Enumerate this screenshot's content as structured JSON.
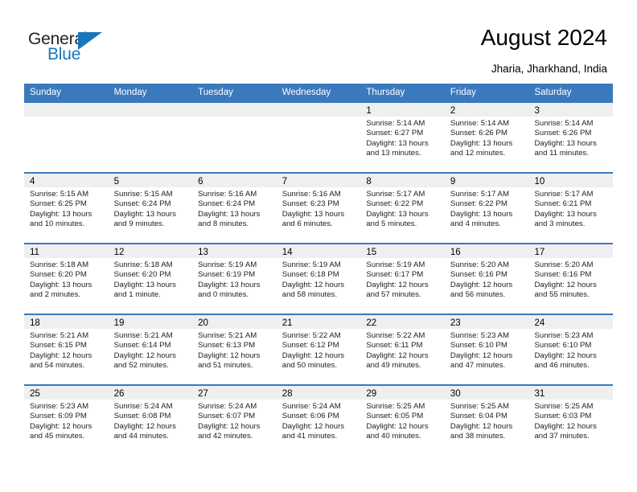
{
  "brand": {
    "name_part1": "General",
    "name_part2": "Blue",
    "triangle_color": "#1b75bb",
    "text_color": "#231f20"
  },
  "header": {
    "title": "August 2024",
    "subtitle": "Jharia, Jharkhand, India"
  },
  "theme": {
    "header_blue": "#3a79bd",
    "row_divider_blue": "#3a79bd",
    "day_band_gray": "#efefef",
    "background": "#ffffff"
  },
  "weekdays": [
    "Sunday",
    "Monday",
    "Tuesday",
    "Wednesday",
    "Thursday",
    "Friday",
    "Saturday"
  ],
  "weeks": [
    [
      {
        "day": "",
        "sunrise": "",
        "sunset": "",
        "daylight_line1": "",
        "daylight_line2": ""
      },
      {
        "day": "",
        "sunrise": "",
        "sunset": "",
        "daylight_line1": "",
        "daylight_line2": ""
      },
      {
        "day": "",
        "sunrise": "",
        "sunset": "",
        "daylight_line1": "",
        "daylight_line2": ""
      },
      {
        "day": "",
        "sunrise": "",
        "sunset": "",
        "daylight_line1": "",
        "daylight_line2": ""
      },
      {
        "day": "1",
        "sunrise": "Sunrise: 5:14 AM",
        "sunset": "Sunset: 6:27 PM",
        "daylight_line1": "Daylight: 13 hours",
        "daylight_line2": "and 13 minutes."
      },
      {
        "day": "2",
        "sunrise": "Sunrise: 5:14 AM",
        "sunset": "Sunset: 6:26 PM",
        "daylight_line1": "Daylight: 13 hours",
        "daylight_line2": "and 12 minutes."
      },
      {
        "day": "3",
        "sunrise": "Sunrise: 5:14 AM",
        "sunset": "Sunset: 6:26 PM",
        "daylight_line1": "Daylight: 13 hours",
        "daylight_line2": "and 11 minutes."
      }
    ],
    [
      {
        "day": "4",
        "sunrise": "Sunrise: 5:15 AM",
        "sunset": "Sunset: 6:25 PM",
        "daylight_line1": "Daylight: 13 hours",
        "daylight_line2": "and 10 minutes."
      },
      {
        "day": "5",
        "sunrise": "Sunrise: 5:15 AM",
        "sunset": "Sunset: 6:24 PM",
        "daylight_line1": "Daylight: 13 hours",
        "daylight_line2": "and 9 minutes."
      },
      {
        "day": "6",
        "sunrise": "Sunrise: 5:16 AM",
        "sunset": "Sunset: 6:24 PM",
        "daylight_line1": "Daylight: 13 hours",
        "daylight_line2": "and 8 minutes."
      },
      {
        "day": "7",
        "sunrise": "Sunrise: 5:16 AM",
        "sunset": "Sunset: 6:23 PM",
        "daylight_line1": "Daylight: 13 hours",
        "daylight_line2": "and 6 minutes."
      },
      {
        "day": "8",
        "sunrise": "Sunrise: 5:17 AM",
        "sunset": "Sunset: 6:22 PM",
        "daylight_line1": "Daylight: 13 hours",
        "daylight_line2": "and 5 minutes."
      },
      {
        "day": "9",
        "sunrise": "Sunrise: 5:17 AM",
        "sunset": "Sunset: 6:22 PM",
        "daylight_line1": "Daylight: 13 hours",
        "daylight_line2": "and 4 minutes."
      },
      {
        "day": "10",
        "sunrise": "Sunrise: 5:17 AM",
        "sunset": "Sunset: 6:21 PM",
        "daylight_line1": "Daylight: 13 hours",
        "daylight_line2": "and 3 minutes."
      }
    ],
    [
      {
        "day": "11",
        "sunrise": "Sunrise: 5:18 AM",
        "sunset": "Sunset: 6:20 PM",
        "daylight_line1": "Daylight: 13 hours",
        "daylight_line2": "and 2 minutes."
      },
      {
        "day": "12",
        "sunrise": "Sunrise: 5:18 AM",
        "sunset": "Sunset: 6:20 PM",
        "daylight_line1": "Daylight: 13 hours",
        "daylight_line2": "and 1 minute."
      },
      {
        "day": "13",
        "sunrise": "Sunrise: 5:19 AM",
        "sunset": "Sunset: 6:19 PM",
        "daylight_line1": "Daylight: 13 hours",
        "daylight_line2": "and 0 minutes."
      },
      {
        "day": "14",
        "sunrise": "Sunrise: 5:19 AM",
        "sunset": "Sunset: 6:18 PM",
        "daylight_line1": "Daylight: 12 hours",
        "daylight_line2": "and 58 minutes."
      },
      {
        "day": "15",
        "sunrise": "Sunrise: 5:19 AM",
        "sunset": "Sunset: 6:17 PM",
        "daylight_line1": "Daylight: 12 hours",
        "daylight_line2": "and 57 minutes."
      },
      {
        "day": "16",
        "sunrise": "Sunrise: 5:20 AM",
        "sunset": "Sunset: 6:16 PM",
        "daylight_line1": "Daylight: 12 hours",
        "daylight_line2": "and 56 minutes."
      },
      {
        "day": "17",
        "sunrise": "Sunrise: 5:20 AM",
        "sunset": "Sunset: 6:16 PM",
        "daylight_line1": "Daylight: 12 hours",
        "daylight_line2": "and 55 minutes."
      }
    ],
    [
      {
        "day": "18",
        "sunrise": "Sunrise: 5:21 AM",
        "sunset": "Sunset: 6:15 PM",
        "daylight_line1": "Daylight: 12 hours",
        "daylight_line2": "and 54 minutes."
      },
      {
        "day": "19",
        "sunrise": "Sunrise: 5:21 AM",
        "sunset": "Sunset: 6:14 PM",
        "daylight_line1": "Daylight: 12 hours",
        "daylight_line2": "and 52 minutes."
      },
      {
        "day": "20",
        "sunrise": "Sunrise: 5:21 AM",
        "sunset": "Sunset: 6:13 PM",
        "daylight_line1": "Daylight: 12 hours",
        "daylight_line2": "and 51 minutes."
      },
      {
        "day": "21",
        "sunrise": "Sunrise: 5:22 AM",
        "sunset": "Sunset: 6:12 PM",
        "daylight_line1": "Daylight: 12 hours",
        "daylight_line2": "and 50 minutes."
      },
      {
        "day": "22",
        "sunrise": "Sunrise: 5:22 AM",
        "sunset": "Sunset: 6:11 PM",
        "daylight_line1": "Daylight: 12 hours",
        "daylight_line2": "and 49 minutes."
      },
      {
        "day": "23",
        "sunrise": "Sunrise: 5:23 AM",
        "sunset": "Sunset: 6:10 PM",
        "daylight_line1": "Daylight: 12 hours",
        "daylight_line2": "and 47 minutes."
      },
      {
        "day": "24",
        "sunrise": "Sunrise: 5:23 AM",
        "sunset": "Sunset: 6:10 PM",
        "daylight_line1": "Daylight: 12 hours",
        "daylight_line2": "and 46 minutes."
      }
    ],
    [
      {
        "day": "25",
        "sunrise": "Sunrise: 5:23 AM",
        "sunset": "Sunset: 6:09 PM",
        "daylight_line1": "Daylight: 12 hours",
        "daylight_line2": "and 45 minutes."
      },
      {
        "day": "26",
        "sunrise": "Sunrise: 5:24 AM",
        "sunset": "Sunset: 6:08 PM",
        "daylight_line1": "Daylight: 12 hours",
        "daylight_line2": "and 44 minutes."
      },
      {
        "day": "27",
        "sunrise": "Sunrise: 5:24 AM",
        "sunset": "Sunset: 6:07 PM",
        "daylight_line1": "Daylight: 12 hours",
        "daylight_line2": "and 42 minutes."
      },
      {
        "day": "28",
        "sunrise": "Sunrise: 5:24 AM",
        "sunset": "Sunset: 6:06 PM",
        "daylight_line1": "Daylight: 12 hours",
        "daylight_line2": "and 41 minutes."
      },
      {
        "day": "29",
        "sunrise": "Sunrise: 5:25 AM",
        "sunset": "Sunset: 6:05 PM",
        "daylight_line1": "Daylight: 12 hours",
        "daylight_line2": "and 40 minutes."
      },
      {
        "day": "30",
        "sunrise": "Sunrise: 5:25 AM",
        "sunset": "Sunset: 6:04 PM",
        "daylight_line1": "Daylight: 12 hours",
        "daylight_line2": "and 38 minutes."
      },
      {
        "day": "31",
        "sunrise": "Sunrise: 5:25 AM",
        "sunset": "Sunset: 6:03 PM",
        "daylight_line1": "Daylight: 12 hours",
        "daylight_line2": "and 37 minutes."
      }
    ]
  ]
}
